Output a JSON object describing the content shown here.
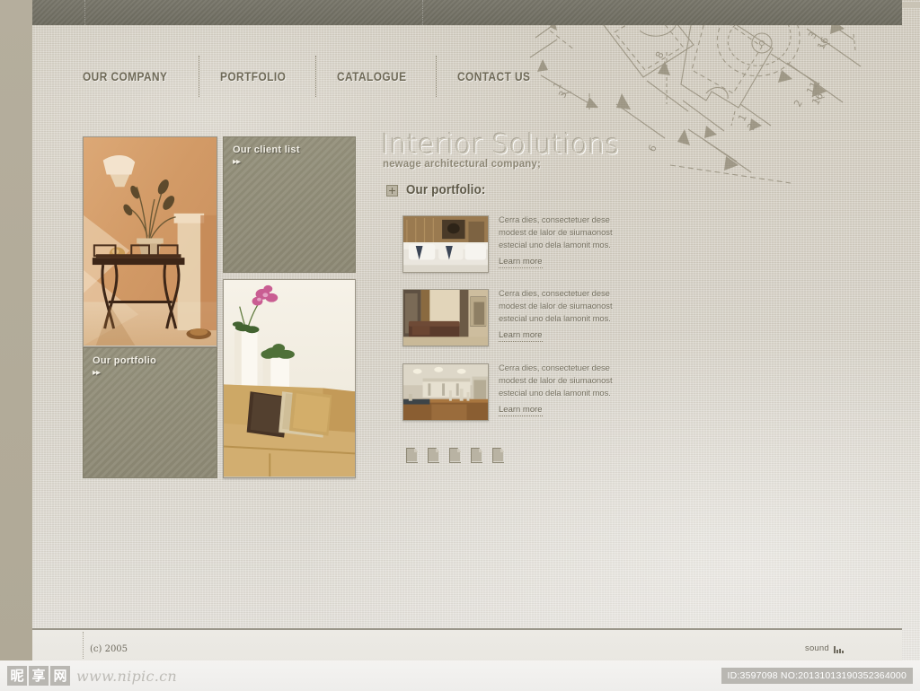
{
  "site": {
    "heading": "Interior Solutions",
    "subheading": "newage architectural company;"
  },
  "nav": {
    "items": [
      {
        "label": "Our company"
      },
      {
        "label": "Portfolio"
      },
      {
        "label": "Catalogue"
      },
      {
        "label": "Contact us"
      }
    ]
  },
  "left_column": {
    "photos": [
      {
        "name": "entryway-console-table",
        "alt": "Warm-toned entryway with wooden console table, dried branch arrangement and wall sconce"
      },
      {
        "name": "living-room-sofa",
        "alt": "Beige sofa with brown and cream cushions, orchid on white pedestal"
      }
    ],
    "panels": [
      {
        "title": "Our client list",
        "chevron": "▸▸"
      },
      {
        "title": "Our portfolio",
        "chevron": "▸▸"
      }
    ]
  },
  "portfolio": {
    "section_icon": "crosshair-square-icon",
    "section_title": "Our portfolio:",
    "items": [
      {
        "thumb": "bedroom-white-linens",
        "lines": [
          "Cerra dies, consectetuer dese",
          "modest de lalor de siumaonost",
          "estecial uno dela lamonit mos."
        ],
        "link": "Learn more"
      },
      {
        "thumb": "bedroom-warm-wood",
        "lines": [
          "Cerra dies, consectetuer dese",
          "modest de lalor de siumaonost",
          "estecial uno dela lamonit mos."
        ],
        "link": "Learn more"
      },
      {
        "thumb": "kitchen-island",
        "lines": [
          "Cerra dies, consectetuer dese",
          "modest de lalor de siumaonost",
          "estecial uno dela lamonit mos."
        ],
        "link": "Learn more"
      }
    ],
    "pager_count": 5
  },
  "footer": {
    "copyright": "(c) 2005",
    "sound_label": "sound"
  },
  "watermark": {
    "cjk": [
      "昵",
      "享",
      "网"
    ],
    "url": "www.nipic.cn",
    "id_text": "ID:3597098 NO:20131013190352364000"
  },
  "colors": {
    "header_bar": "#6e6c60",
    "panel": "#8d8975",
    "page_bg": "#d2ccbf",
    "nav_text": "#6f6a58",
    "heading": "#cdc8ba"
  }
}
